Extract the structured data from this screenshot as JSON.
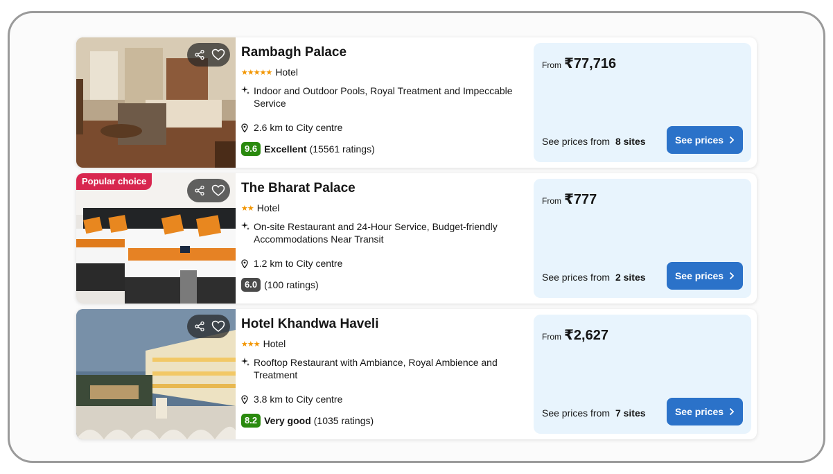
{
  "colors": {
    "accent_button": "#2b72c9",
    "price_panel_bg": "#e8f4fd",
    "stars": "#f29500",
    "score_excellent": "#2a8a0e",
    "score_very_good": "#2a8a0e",
    "score_neutral": "#4a4a4a",
    "popular_badge": "#d8264f"
  },
  "hotels": [
    {
      "name": "Rambagh Palace",
      "stars": "★★★★★",
      "type": "Hotel",
      "feature": "Indoor and Outdoor Pools, Royal Treatment and Impeccable Service",
      "distance": "2.6 km to City centre",
      "score": "9.6",
      "rating_label": "Excellent",
      "ratings_count": "(15561 ratings)",
      "from_label": "From",
      "price": "₹77,716",
      "sites_prefix": "See prices from",
      "sites": "8 sites",
      "button": "See prices",
      "badge": ""
    },
    {
      "name": "The Bharat Palace",
      "stars": "★★",
      "type": "Hotel",
      "feature": "On-site Restaurant and 24-Hour Service, Budget-friendly Accommodations Near Transit",
      "distance": "1.2 km to City centre",
      "score": "6.0",
      "rating_label": "",
      "ratings_count": "(100 ratings)",
      "from_label": "From",
      "price": "₹777",
      "sites_prefix": "See prices from",
      "sites": "2 sites",
      "button": "See prices",
      "badge": "Popular choice"
    },
    {
      "name": "Hotel Khandwa Haveli",
      "stars": "★★★",
      "type": "Hotel",
      "feature": "Rooftop Restaurant with Ambiance, Royal Ambience and Treatment",
      "distance": "3.8 km to City centre",
      "score": "8.2",
      "rating_label": "Very good",
      "ratings_count": "(1035 ratings)",
      "from_label": "From",
      "price": "₹2,627",
      "sites_prefix": "See prices from",
      "sites": "7 sites",
      "button": "See prices",
      "badge": ""
    }
  ],
  "icons": {
    "share": "share-icon",
    "favorite": "heart-icon",
    "sparkle": "sparkle-icon",
    "location": "location-pin-icon",
    "chevron": "chevron-right-icon"
  }
}
